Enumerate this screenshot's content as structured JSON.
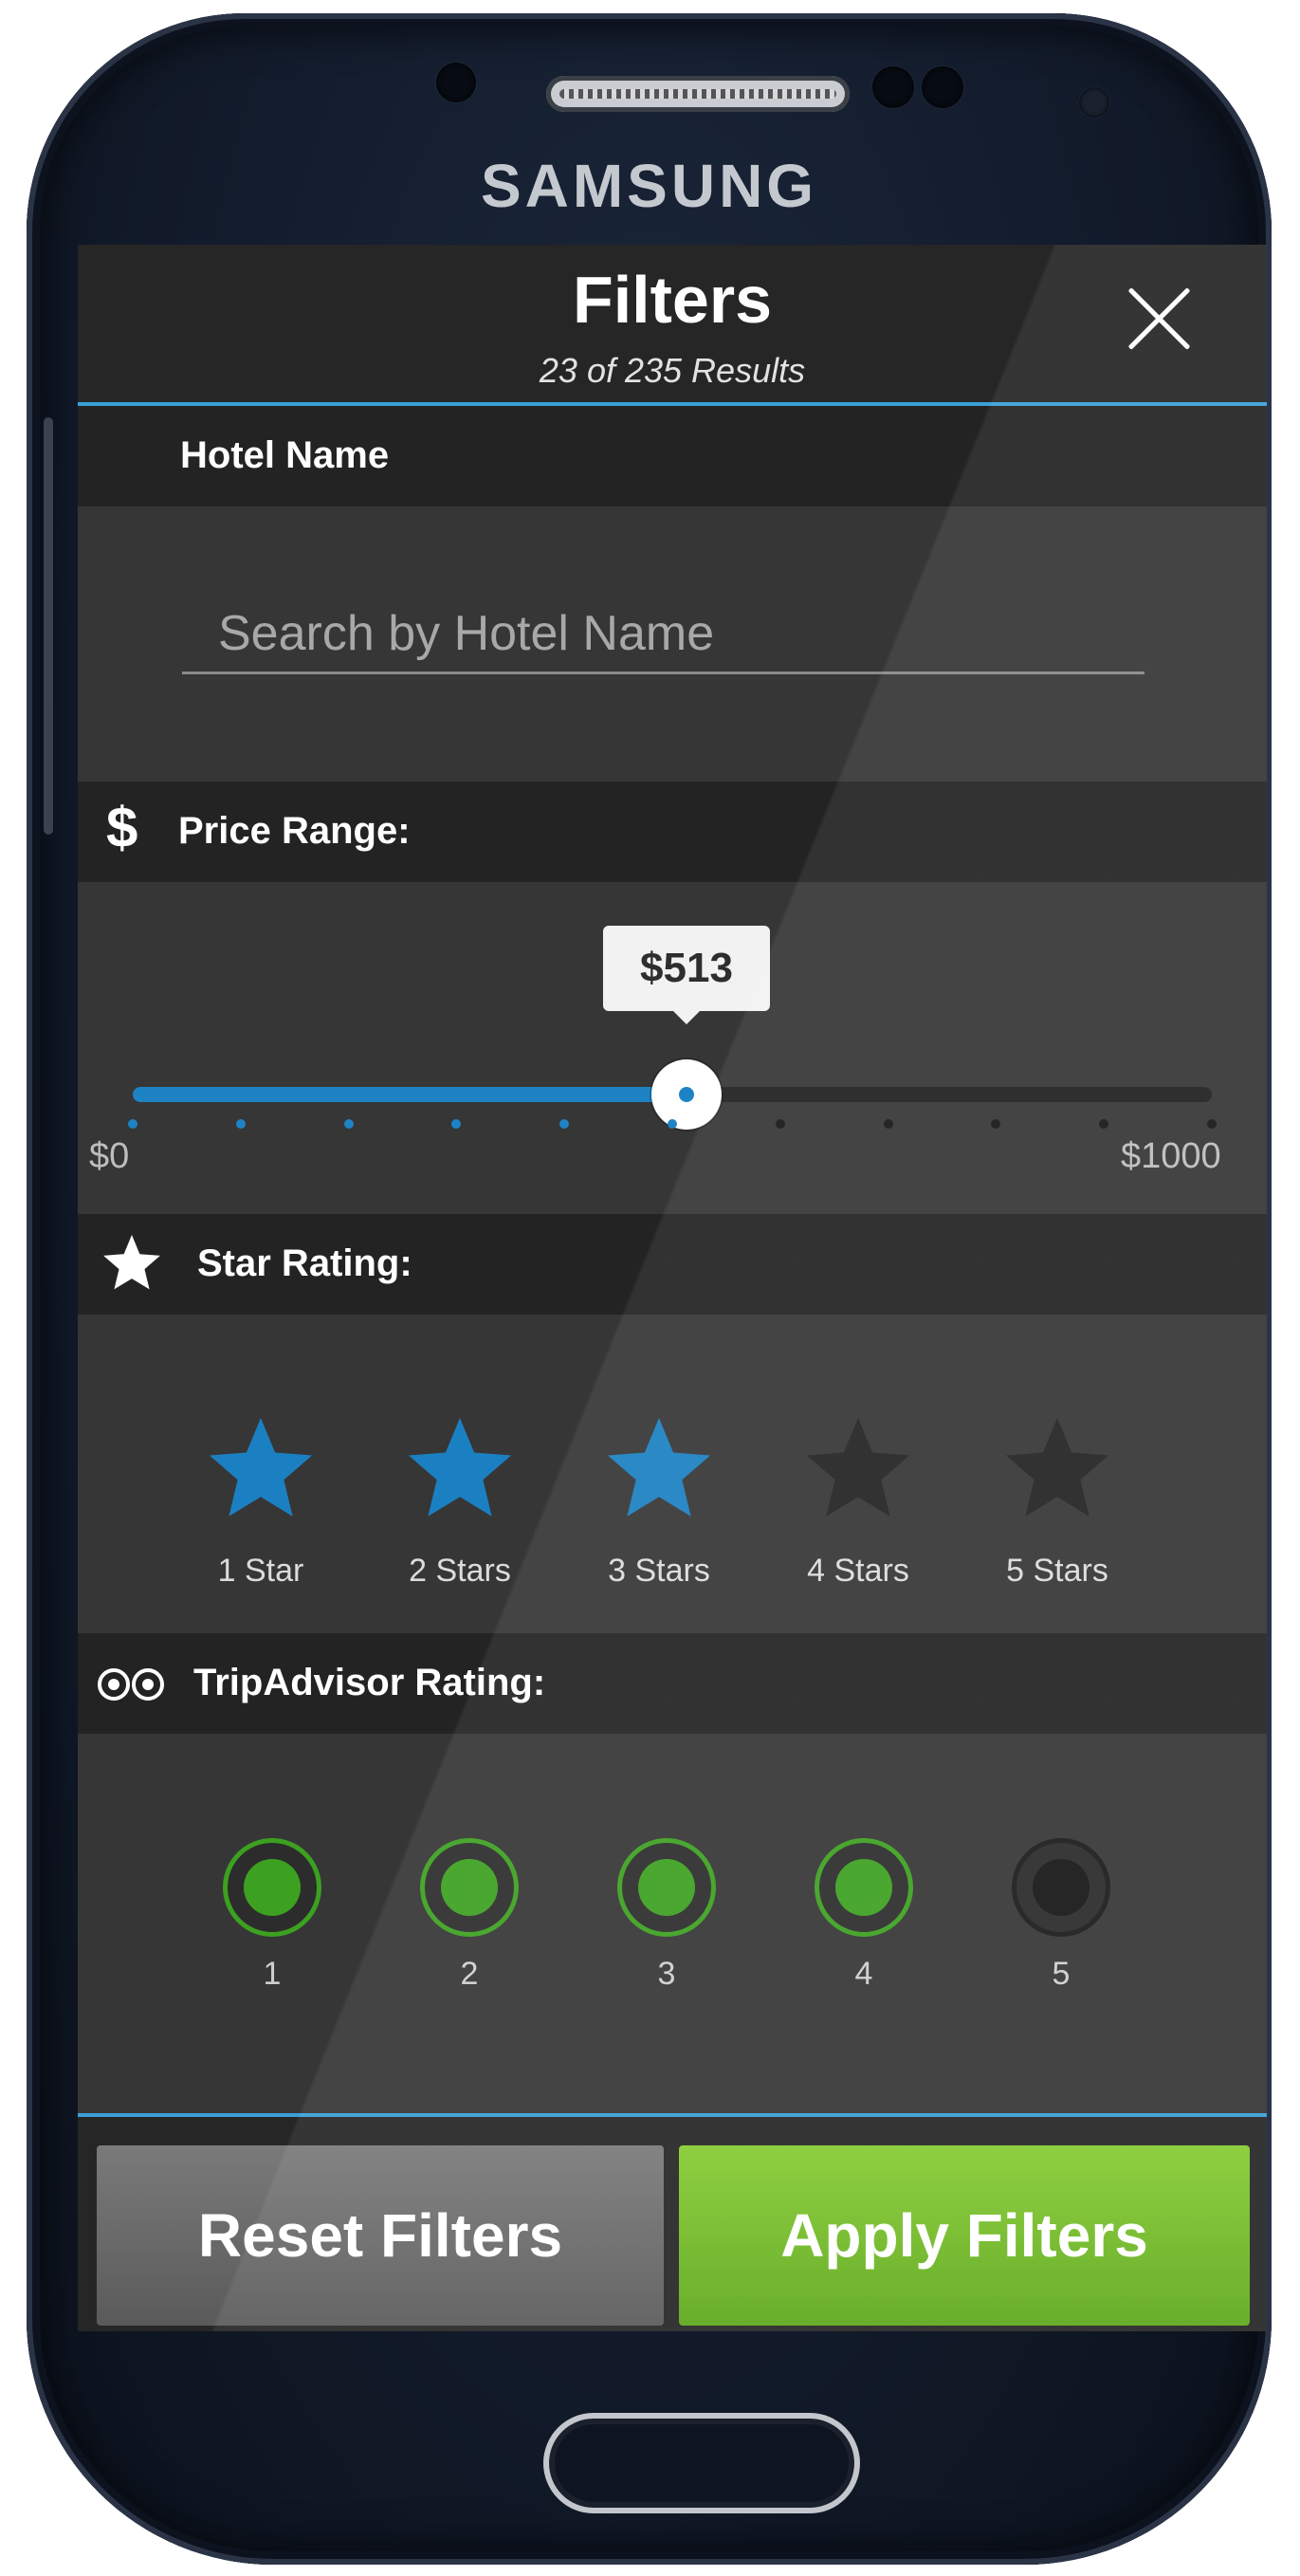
{
  "device": {
    "brand": "SAMSUNG"
  },
  "header": {
    "title": "Filters",
    "subtitle": "23 of 235 Results",
    "close_icon": "close-icon"
  },
  "hotel_name": {
    "label": "Hotel Name",
    "placeholder": "Search by Hotel Name",
    "value": ""
  },
  "price_range": {
    "label": "Price Range:",
    "icon": "$",
    "min_label": "$0",
    "max_label": "$1000",
    "min": 0,
    "max": 1000,
    "value": 513,
    "value_label": "$513",
    "tick_count": 11,
    "colors": {
      "active": "#1e83c4",
      "inactive": "#1f1f1f"
    }
  },
  "star_rating": {
    "label": "Star Rating:",
    "icon": "star-icon",
    "options": [
      {
        "label": "1 Star",
        "selected": true
      },
      {
        "label": "2 Stars",
        "selected": true
      },
      {
        "label": "3 Stars",
        "selected": true
      },
      {
        "label": "4 Stars",
        "selected": false
      },
      {
        "label": "5 Stars",
        "selected": false
      }
    ],
    "colors": {
      "selected": "#1b80c2",
      "unselected": "#222222"
    }
  },
  "tripadvisor_rating": {
    "label": "TripAdvisor Rating:",
    "icon": "owl-eyes-icon",
    "options": [
      {
        "label": "1",
        "selected": true
      },
      {
        "label": "2",
        "selected": true
      },
      {
        "label": "3",
        "selected": true
      },
      {
        "label": "4",
        "selected": true
      },
      {
        "label": "5",
        "selected": false
      }
    ],
    "colors": {
      "selected": "#3ca020"
    }
  },
  "footer": {
    "reset_label": "Reset Filters",
    "apply_label": "Apply Filters",
    "colors": {
      "apply": "#6cb524",
      "reset": "#6a6a6a"
    }
  }
}
